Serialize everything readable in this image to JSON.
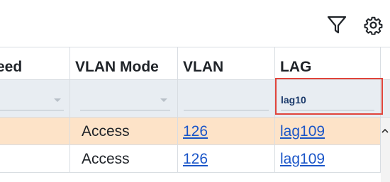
{
  "toolbar": {
    "filter_icon": "filter-icon",
    "settings_icon": "gear-icon"
  },
  "columns": [
    {
      "key": "speed",
      "label": "eed"
    },
    {
      "key": "vlan_mode",
      "label": "VLAN Mode"
    },
    {
      "key": "vlan",
      "label": "VLAN"
    },
    {
      "key": "lag",
      "label": "LAG"
    }
  ],
  "filters": {
    "speed": "",
    "vlan_mode": "",
    "vlan": "",
    "lag": "lag10"
  },
  "rows": [
    {
      "selected": true,
      "speed": "",
      "vlan_mode": "Access",
      "vlan": "126",
      "lag": "lag109"
    },
    {
      "selected": false,
      "speed": "",
      "vlan_mode": "Access",
      "vlan": "126",
      "lag": "lag109"
    }
  ],
  "colors": {
    "selected_row": "#fde3c8",
    "filter_row": "#e8edf2",
    "link": "#1a55c8",
    "highlight": "#e0443b"
  }
}
